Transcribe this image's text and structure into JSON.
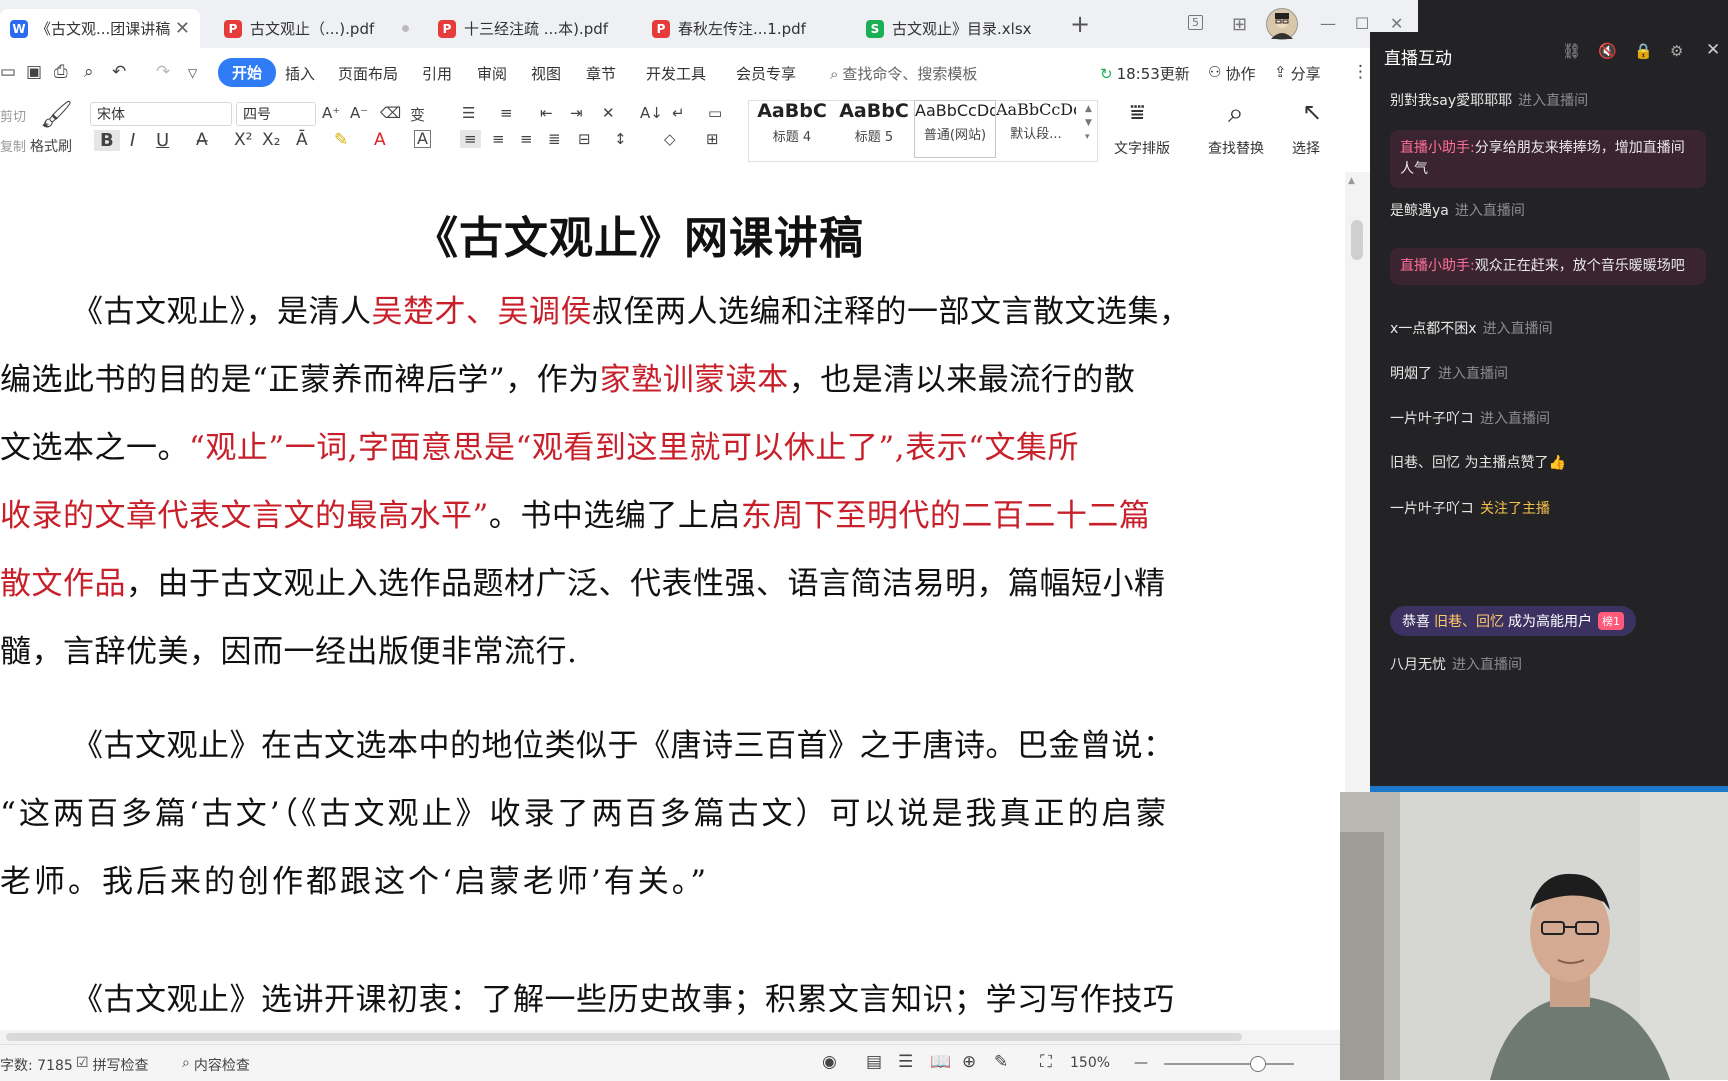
{
  "tabs": [
    {
      "label": "《古文观...团课讲稿",
      "kind": "W",
      "color": "#2a6bf2",
      "active": true
    },
    {
      "label": "古文观止（...).pdf",
      "kind": "P",
      "color": "#e63b3b"
    },
    {
      "label": "十三经注疏 ...本).pdf",
      "kind": "P",
      "color": "#e63b3b"
    },
    {
      "label": "春秋左传注...1.pdf",
      "kind": "P",
      "color": "#e63b3b"
    },
    {
      "label": "古文观止》目录.xlsx",
      "kind": "S",
      "color": "#1aae55"
    }
  ],
  "window": {
    "new_tab": "+",
    "page_count": "5"
  },
  "menu": {
    "items": [
      "开始",
      "插入",
      "页面布局",
      "引用",
      "审阅",
      "视图",
      "章节",
      "开发工具",
      "会员专享"
    ],
    "search_placeholder": "查找命令、搜索模板",
    "sync": "18:53更新",
    "collab": "协作",
    "share": "分享"
  },
  "ribbon": {
    "cut": "剪切",
    "copy": "复制",
    "format_painter": "格式刷",
    "font_name": "宋体",
    "font_size": "四号",
    "styles": [
      {
        "sample": "AaBbC",
        "label": "标题 4"
      },
      {
        "sample": "AaBbC",
        "label": "标题 5"
      },
      {
        "sample": "AaBbCcDd",
        "label": "普通(网站)"
      },
      {
        "sample": "AaBbCcDd",
        "label": "默认段..."
      }
    ],
    "text_layout": "文字排版",
    "find_replace": "查找替换",
    "select": "选择"
  },
  "document": {
    "title": "《古文观止》网课讲稿",
    "p1": [
      [
        {
          "t": "《古文观止》，是清人"
        },
        {
          "t": "吴楚才、吴调侯",
          "red": true
        },
        {
          "t": "叔侄两人选编和注释的一部文言散文选集，"
        }
      ],
      [
        {
          "t": "编选此书的目的是“正蒙养而裨后学”，作为"
        },
        {
          "t": "家塾训蒙读本",
          "red": true
        },
        {
          "t": "，也是清以来最流行的散"
        }
      ],
      [
        {
          "t": "文选本之一。"
        },
        {
          "t": "“观止”一词,字面意思是“观看到这里就可以休止了”,表示“文集所",
          "red": true
        }
      ],
      [
        {
          "t": "收录的文章代表文言文的最高水平”",
          "red": true
        },
        {
          "t": "。书中选编了上启"
        },
        {
          "t": "东周下至明代的二百二十二篇",
          "red": true
        }
      ],
      [
        {
          "t": "散文作品",
          "red": true
        },
        {
          "t": "，由于古文观止入选作品题材广泛、代表性强、语言简洁易明，篇幅短小精"
        }
      ],
      [
        {
          "t": "髓，言辞优美，因而一经出版便非常流行."
        }
      ]
    ],
    "p2": [
      "《古文观止》在古文选本中的地位类似于《唐诗三百首》之于唐诗。巴金曾说：",
      "“这两百多篇‘古文’（《古文观止》收录了两百多篇古文）可以说是我真正的启蒙",
      "老师。我后来的创作都跟这个‘启蒙老师’有关。”"
    ],
    "p3": "《古文观止》选讲开课初衷：了解一些历史故事；积累文言知识；学习写作技巧"
  },
  "statusbar": {
    "word_count": "字数: 7185",
    "spell_check": "拼写检查",
    "content_check": "内容检查",
    "zoom": "150%"
  },
  "live": {
    "title": "直播互动",
    "messages": [
      {
        "user": "别對我say愛耶耶耶",
        "action": "进入直播间"
      },
      {
        "bubble": true,
        "who": "直播小助手:",
        "text": "分享给朋友来捧捧场，增加直播间人气"
      },
      {
        "user": "是鲸遇ya",
        "action": "进入直播间"
      },
      {
        "bubble": true,
        "who": "直播小助手:",
        "text": "观众正在赶来，放个音乐暖暖场吧"
      },
      {
        "user": "x一点都不困x",
        "action": "进入直播间"
      },
      {
        "user": "明烟了",
        "action": "进入直播间"
      },
      {
        "user": "一片叶子吖コ",
        "action": "进入直播间"
      },
      {
        "user": "旧巷、回忆 为主播点赞了",
        "action": "",
        "thumb": true
      },
      {
        "user": "一片叶子吖コ",
        "action": "关注了主播",
        "gold": true
      },
      {
        "congrats": true,
        "prefix": "恭喜",
        "name": "旧巷、回忆",
        "suffix": "成为高能用户",
        "badge": "榜1"
      },
      {
        "user": "八月无忧",
        "action": "进入直播间"
      }
    ]
  },
  "colors": {
    "accent": "#2f7cf6",
    "red_text": "#c8202a",
    "live_bg": "#232326"
  }
}
